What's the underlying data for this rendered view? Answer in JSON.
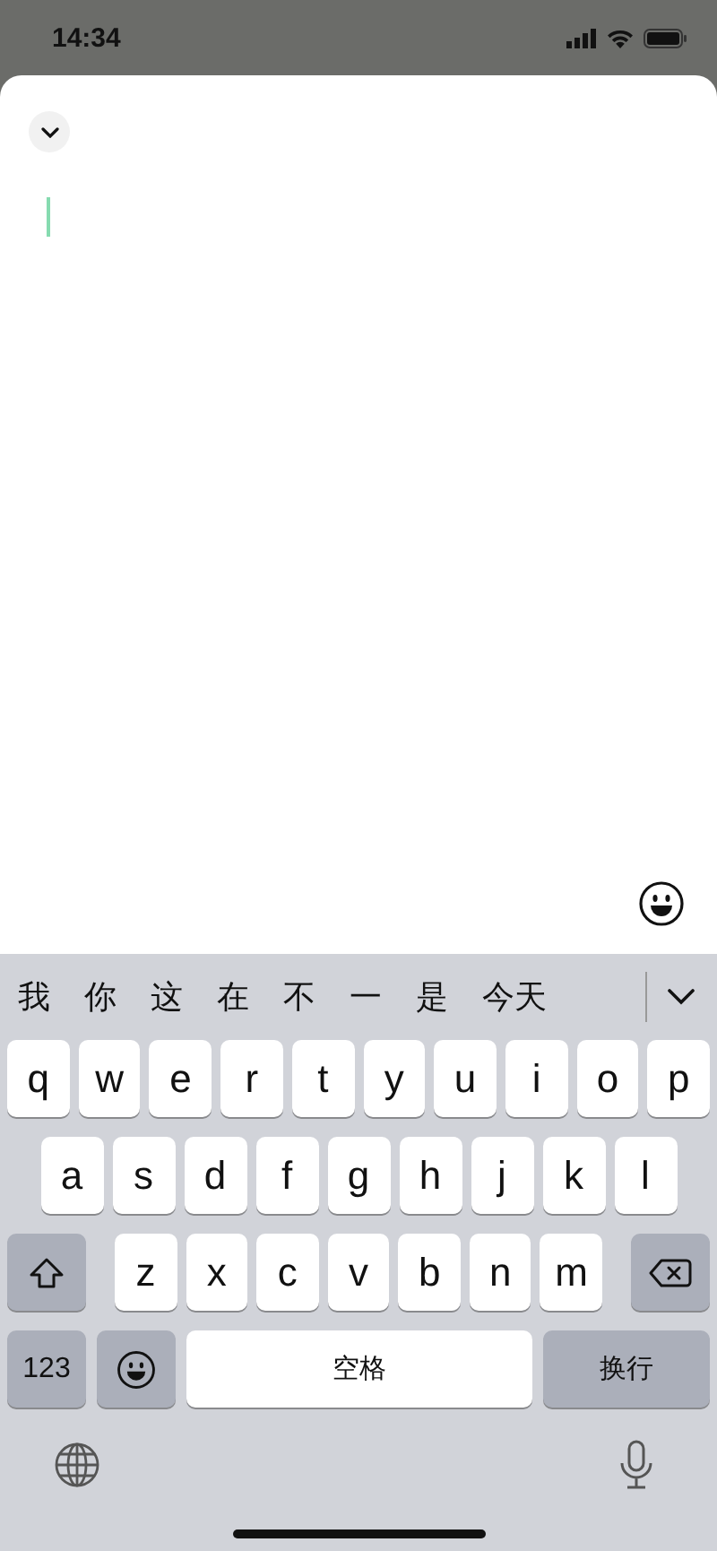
{
  "status_bar": {
    "time": "14:34"
  },
  "candidates": [
    "我",
    "你",
    "这",
    "在",
    "不",
    "一",
    "是",
    "今天"
  ],
  "keyboard": {
    "rows": [
      {
        "keys": [
          {
            "kind": "letter",
            "label": "q"
          },
          {
            "kind": "letter",
            "label": "w"
          },
          {
            "kind": "letter",
            "label": "e"
          },
          {
            "kind": "letter",
            "label": "r"
          },
          {
            "kind": "letter",
            "label": "t"
          },
          {
            "kind": "letter",
            "label": "y"
          },
          {
            "kind": "letter",
            "label": "u"
          },
          {
            "kind": "letter",
            "label": "i"
          },
          {
            "kind": "letter",
            "label": "o"
          },
          {
            "kind": "letter",
            "label": "p"
          }
        ]
      },
      {
        "keys": [
          {
            "kind": "letter",
            "label": "a"
          },
          {
            "kind": "letter",
            "label": "s"
          },
          {
            "kind": "letter",
            "label": "d"
          },
          {
            "kind": "letter",
            "label": "f"
          },
          {
            "kind": "letter",
            "label": "g"
          },
          {
            "kind": "letter",
            "label": "h"
          },
          {
            "kind": "letter",
            "label": "j"
          },
          {
            "kind": "letter",
            "label": "k"
          },
          {
            "kind": "letter",
            "label": "l"
          }
        ]
      },
      {
        "keys": [
          {
            "kind": "shift"
          },
          {
            "kind": "letter",
            "label": "z"
          },
          {
            "kind": "letter",
            "label": "x"
          },
          {
            "kind": "letter",
            "label": "c"
          },
          {
            "kind": "letter",
            "label": "v"
          },
          {
            "kind": "letter",
            "label": "b"
          },
          {
            "kind": "letter",
            "label": "n"
          },
          {
            "kind": "letter",
            "label": "m"
          },
          {
            "kind": "delete"
          }
        ]
      },
      {
        "keys": [
          {
            "kind": "function",
            "label": "123"
          },
          {
            "kind": "emoji"
          },
          {
            "kind": "space",
            "label": "空格"
          },
          {
            "kind": "return",
            "label": "换行"
          }
        ]
      }
    ]
  }
}
